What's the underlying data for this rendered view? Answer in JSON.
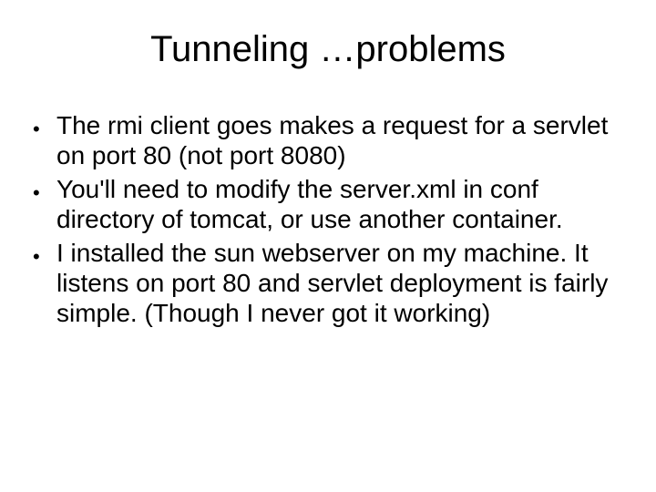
{
  "slide": {
    "title": "Tunneling …problems",
    "bullets": [
      "The rmi client goes makes a request for a servlet on port 80 (not port 8080)",
      "You'll need to modify the server.xml in conf directory of tomcat, or use another container.",
      "I installed the sun webserver on my machine. It listens on port 80 and servlet deployment is fairly simple. (Though I never got it working)"
    ]
  }
}
